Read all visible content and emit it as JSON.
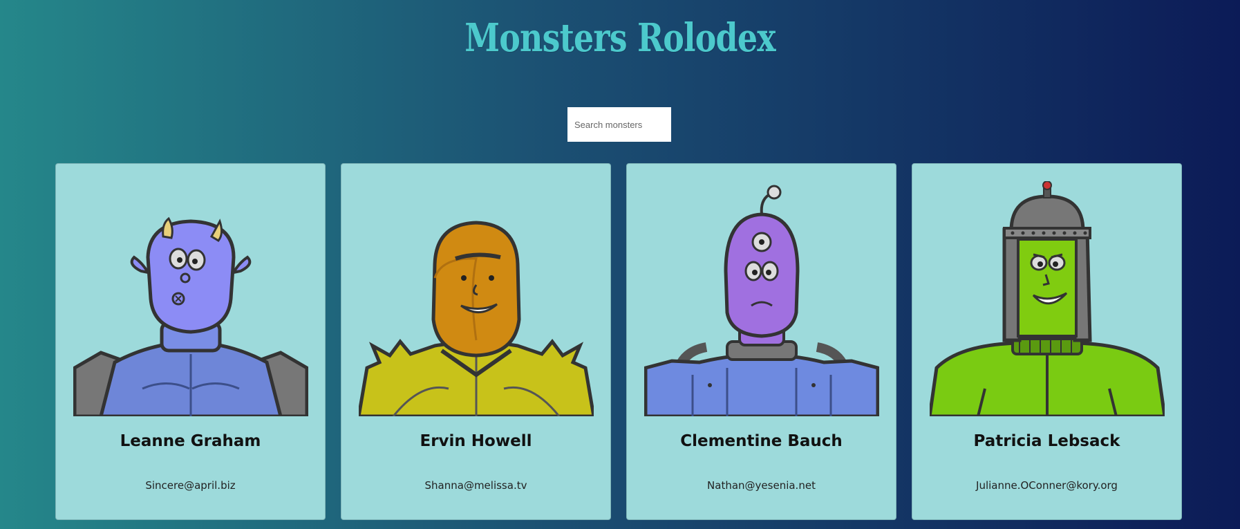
{
  "page": {
    "title": "Monsters Rolodex",
    "colors": {
      "title": "#4cc9cc",
      "card_background": "#9ddadb",
      "gradient_left": "#25878a",
      "gradient_right": "#0c1b57"
    }
  },
  "search": {
    "placeholder": "Search monsters",
    "value": ""
  },
  "monsters": [
    {
      "name": "Leanne Graham",
      "email": "Sincere@april.biz",
      "avatar": "blue-horned-monster",
      "skin": "#8c8cf5",
      "suit": "#6e86d8"
    },
    {
      "name": "Ervin Howell",
      "email": "Shanna@melissa.tv",
      "avatar": "orange-hooded-monster",
      "skin": "#d08a12",
      "suit": "#c8c21a"
    },
    {
      "name": "Clementine Bauch",
      "email": "Nathan@yesenia.net",
      "avatar": "purple-three-eyed-robot-monster",
      "skin": "#a070e0",
      "suit": "#6e8ae0"
    },
    {
      "name": "Patricia Lebsack",
      "email": "Julianne.OConner@kory.org",
      "avatar": "green-helmet-monster",
      "skin": "#80cc10",
      "suit": "#7acb12"
    }
  ]
}
